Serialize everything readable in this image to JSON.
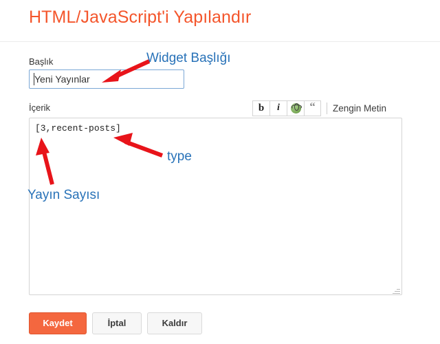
{
  "header": {
    "title": "HTML/JavaScript'i Yapılandır",
    "title_color": "#f4552b"
  },
  "form": {
    "title_field": {
      "label": "Başlık",
      "value": "Yeni Yayınlar",
      "placeholder": "",
      "focused": true,
      "border_color": "#7aa7d6"
    },
    "body_field": {
      "label": "İçerik",
      "value": "[3,recent-posts]",
      "placeholder": "",
      "border_color": "#d4d4d4"
    }
  },
  "toolbar": {
    "bold_label": "b",
    "italic_label": "i",
    "link_icon_name": "globe-icon",
    "quote_label": "“",
    "rich_text_label": "Zengin Metin"
  },
  "footer": {
    "save_label": "Kaydet",
    "cancel_label": "İptal",
    "remove_label": "Kaldır",
    "save_bg": "#f4673f"
  },
  "annotations": {
    "color": "#2872b8",
    "arrow_color": "#e8141a",
    "widget_title": "Widget Başlığı",
    "type": "type",
    "post_count": "Yayın Sayısı"
  }
}
